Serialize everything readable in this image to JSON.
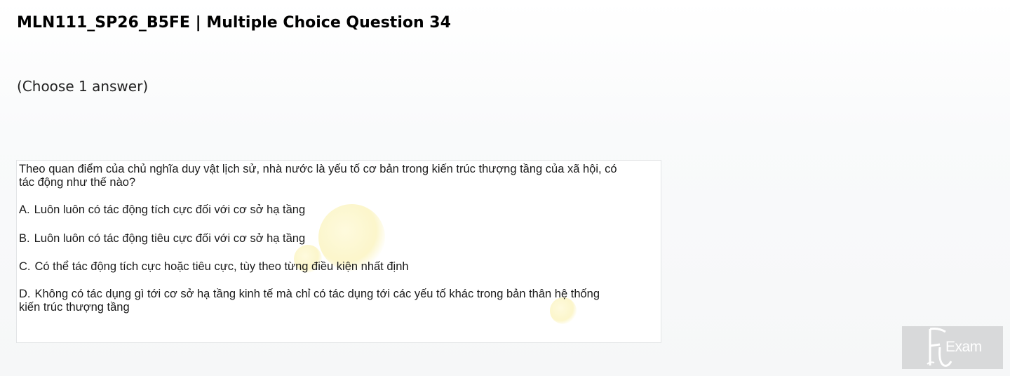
{
  "header": {
    "title": "MLN111_SP26_B5FE | Multiple Choice Question 34"
  },
  "instruction": "(Choose 1 answer)",
  "question": {
    "text": "Theo quan điểm của chủ nghĩa duy vật lịch sử, nhà nước là yếu tố cơ bản trong kiến trúc thượng tầng của xã hội, có tác động như thế nào?",
    "options": [
      {
        "letter": "A.",
        "text": "Luôn luôn có tác động tích cực đối với cơ sở hạ tầng"
      },
      {
        "letter": "B.",
        "text": "Luôn luôn có tác động tiêu cực đối với cơ sở hạ tầng"
      },
      {
        "letter": "C.",
        "text": "Có thể tác động tích cực hoặc tiêu cực, tùy theo từng điều kiện nhất định"
      },
      {
        "letter": "D.",
        "text": "Không có tác dụng gì tới cơ sở hạ tầng kinh tế mà chỉ có tác dụng tới các yếu tố khác trong bản thân hệ thống kiến trúc thượng tầng"
      }
    ]
  },
  "watermark": {
    "logo_text": "Exam",
    "background_color": "#d8d9da"
  }
}
